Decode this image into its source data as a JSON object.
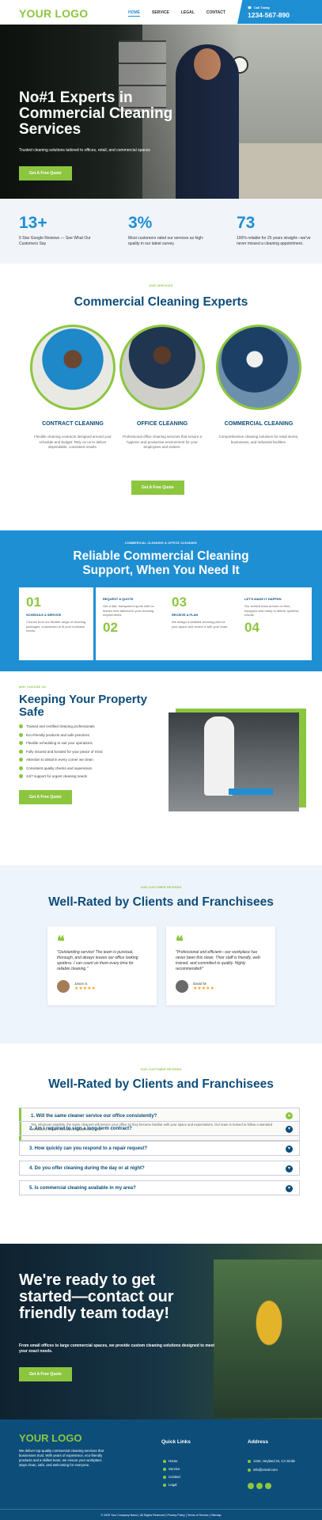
{
  "header": {
    "logo_a": "YOUR ",
    "logo_b": "LOGO",
    "nav": [
      "HOME",
      "SERVICE",
      "LEGAL",
      "CONTACT"
    ],
    "call_label": "Call Today",
    "phone": "1234-567-890"
  },
  "hero": {
    "title": "No#1 Experts in Commercial Cleaning Services",
    "subtitle": "Trusted cleaning solutions tailored to offices, retail, and commercial spaces",
    "button": "Get A Free Quote"
  },
  "stats": [
    {
      "num": "13+",
      "text": "5 Star Google Reviews — See What Our Customers Say"
    },
    {
      "num": "3%",
      "text": "Most customers rated our services as high-quality in our latest survey."
    },
    {
      "num": "73",
      "text": "100% reliable for 25 years straight—we've never missed a cleaning appointment."
    }
  ],
  "services": {
    "kicker": "OUR SERVICES",
    "title": "Commercial Cleaning Experts",
    "items": [
      {
        "title": "CONTRACT CLEANING",
        "desc": "Flexible cleaning contracts designed around your schedule and budget. Rely on us to deliver dependable, consistent results."
      },
      {
        "title": "OFFICE CLEANING",
        "desc": "Professional office cleaning services that ensure a hygienic and productive environment for your employees and visitors."
      },
      {
        "title": "COMMERCIAL CLEANING",
        "desc": "Comprehensive cleaning solutions for retail stores, businesses, and industrial facilities."
      }
    ],
    "button": "Get A Free Quote"
  },
  "process": {
    "kicker": "COMMERCIAL CLEANING & OFFICE CLEANING",
    "title": "Reliable Commercial Cleaning Support, When You Need It",
    "cards": [
      {
        "n": "01",
        "t": "SCHEDULE A SERVICE",
        "d": "Choose from our flexible range of cleaning packages, customized to fit your business needs."
      },
      {
        "n": "02",
        "t": "REQUEST A QUOTE",
        "d": "Get a fast, transparent quote with no hidden fees tailored to your cleaning requirements."
      },
      {
        "n": "03",
        "t": "RECEIVE A PLAN",
        "d": "We design a detailed cleaning plan for your space and review it with your team."
      },
      {
        "n": "04",
        "t": "LET'S MAKE IT HAPPEN",
        "d": "Our trusted team arrives on time, equipped and ready to deliver spotless results."
      }
    ]
  },
  "why": {
    "kicker": "WHY CHOOSE US",
    "title": "Keeping Your Property Safe",
    "checks": [
      "Trained and certified cleaning professionals",
      "Eco-friendly products and safe practices",
      "Flexible scheduling to suit your operations",
      "Fully insured and bonded for your peace of mind",
      "Attention to detail in every corner we clean",
      "Consistent quality checks and supervision",
      "24/7 support for urgent cleaning needs"
    ],
    "button": "Get A Free Quote"
  },
  "reviews": {
    "kicker": "OUR CUSTOMER REVIEWS",
    "title": "Well-Rated by Clients and Franchisees",
    "items": [
      {
        "text": "\"Outstanding service! The team is punctual, thorough, and always leaves our office looking spotless. I can count on them every time for reliable cleaning.\"",
        "name": "Jason S.",
        "stars": "★★★★★"
      },
      {
        "text": "\"Professional and efficient—our workplace has never been this clean. Their staff is friendly, well-trained, and committed to quality. Highly recommended!\"",
        "name": "David M.",
        "stars": "★★★★★"
      }
    ]
  },
  "faq": {
    "kicker": "OUR CUSTOMER REVIEWS",
    "title": "Well-Rated by Clients and Franchisees",
    "open_q": "1. Will the same cleaner service our office consistently?",
    "open_a": "Yes, wherever possible, the same cleaners will service your office so they become familiar with your space and expectations. Our team is trained to follow a standard checklist to ensure consistent results every visit.",
    "questions": [
      "2. Am I required to sign a long-term contract?",
      "3. How quickly can you respond to a repair request?",
      "4. Do you offer cleaning during the day or at night?",
      "5. Is commercial cleaning available in my area?"
    ]
  },
  "cta": {
    "title": "We're ready to get started—contact our friendly team today!",
    "text": "From small offices to large commercial spaces, we provide custom cleaning solutions designed to meet your exact needs.",
    "button": "Get A Free Quote"
  },
  "footer": {
    "logo_a": "YOUR ",
    "logo_b": "LOGO",
    "desc": "We deliver top-quality commercial cleaning services that businesses trust. With years of experience, eco-friendly products and a skilled team, we ensure your workplace stays clean, safe, and welcoming for everyone.",
    "links_title": "Quick Links",
    "links": [
      "Home",
      "Service",
      "Contact",
      "Legal"
    ],
    "address_title": "Address",
    "address": "1234, Heyland St, CA Smile",
    "email": "info@email.com",
    "copyright": "© 2025 Your Company Name | All Rights Reserved | Privacy Policy | Terms of Service | Sitemap"
  }
}
